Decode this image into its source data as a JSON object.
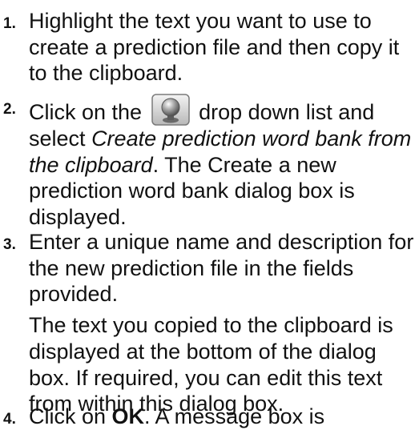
{
  "steps": [
    {
      "num": "1.",
      "text": "Highlight the text you want to use to create a prediction file and then copy it to the clipboard."
    },
    {
      "num": "2.",
      "pre": "Click on the",
      "icon": "prediction-word-bank-icon",
      "mid": "drop down list and select",
      "italic": "Create prediction word bank from the clipboard",
      "post": ". The Create a new prediction word bank dialog box is displayed."
    },
    {
      "num": "3.",
      "text": "Enter a unique name and description for the new prediction file in the fields provided.",
      "extra": "The text you copied to the clipboard is displayed at the bottom of the dialog box. If required, you can edit this text from within this dialog box."
    },
    {
      "num": "4.",
      "pre": "Click on",
      "bold": "OK",
      "post": ". A message box is"
    }
  ]
}
